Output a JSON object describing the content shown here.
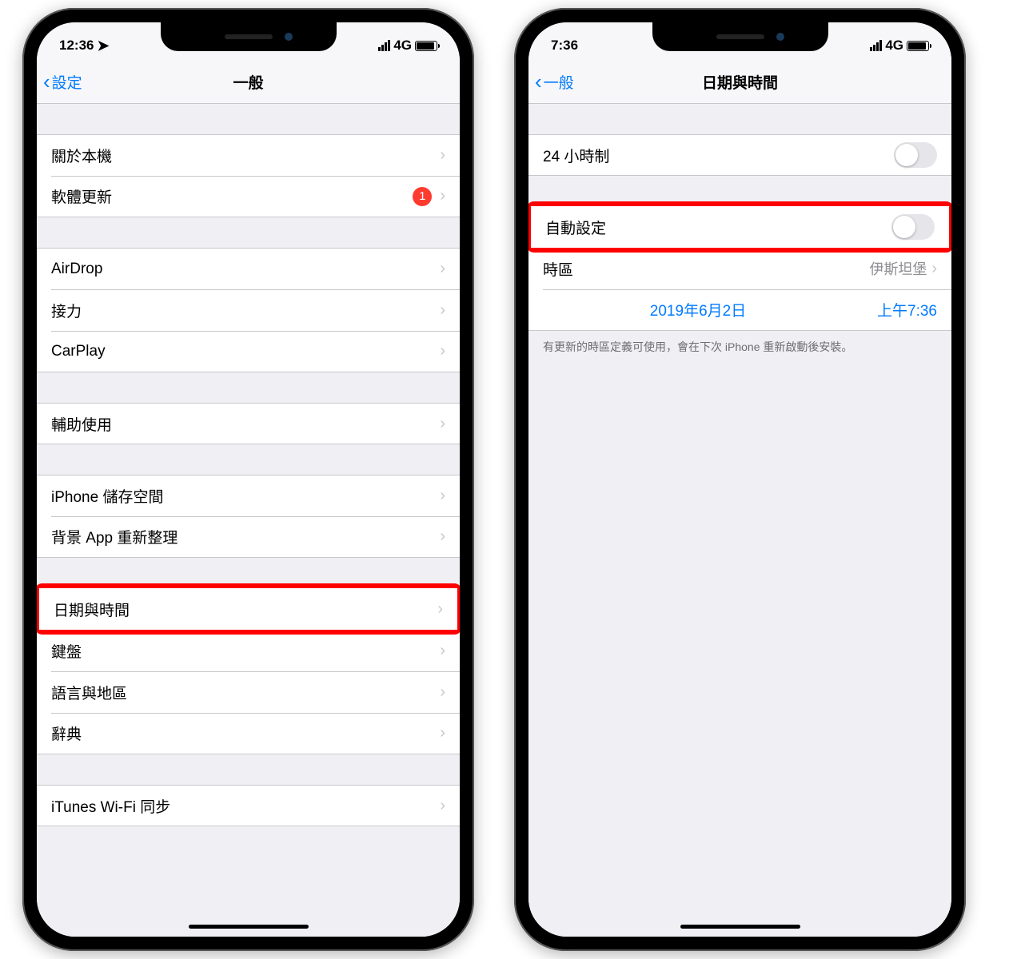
{
  "left": {
    "status": {
      "time": "12:36",
      "network": "4G"
    },
    "nav": {
      "back": "設定",
      "title": "一般"
    },
    "groups": [
      {
        "items": [
          {
            "label": "關於本機"
          },
          {
            "label": "軟體更新",
            "badge": "1"
          }
        ]
      },
      {
        "items": [
          {
            "label": "AirDrop"
          },
          {
            "label": "接力"
          },
          {
            "label": "CarPlay"
          }
        ]
      },
      {
        "items": [
          {
            "label": "輔助使用"
          }
        ]
      },
      {
        "items": [
          {
            "label": "iPhone 儲存空間"
          },
          {
            "label": "背景 App 重新整理"
          }
        ]
      },
      {
        "items": [
          {
            "label": "日期與時間",
            "highlighted": true
          },
          {
            "label": "鍵盤"
          },
          {
            "label": "語言與地區"
          },
          {
            "label": "辭典"
          }
        ]
      },
      {
        "items": [
          {
            "label": "iTunes Wi-Fi 同步"
          }
        ]
      }
    ]
  },
  "right": {
    "status": {
      "time": "7:36",
      "network": "4G"
    },
    "nav": {
      "back": "一般",
      "title": "日期與時間"
    },
    "row_24h": "24 小時制",
    "row_auto": "自動設定",
    "row_tz": {
      "label": "時區",
      "value": "伊斯坦堡"
    },
    "row_dt": {
      "date": "2019年6月2日",
      "time": "上午7:36"
    },
    "footer": "有更新的時區定義可使用，會在下次 iPhone 重新啟動後安裝。"
  }
}
